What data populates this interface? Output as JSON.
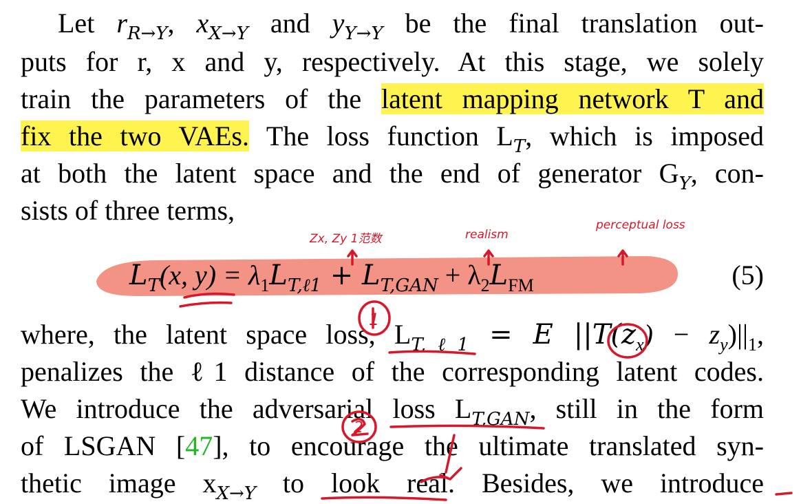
{
  "paragraph1": {
    "l1": [
      "Let ",
      "r",
      "R→Y",
      ", ",
      "x",
      "X→Y",
      " and ",
      "y",
      "Y→Y",
      " be the final translation out-"
    ],
    "l2": "puts for r, x and y, respectively. At this stage, we solely",
    "l3_pre": "train the parameters of the ",
    "l3_hl": "latent mapping network T and",
    "l4_hl": "fix the two VAEs.",
    "l4_post": " The loss function L",
    "l4_sub": "T",
    "l4_tail": ", which is imposed",
    "l5": "at both the latent space and the end of generator G",
    "l5_sub": "Y",
    "l5_tail": ", con-",
    "l6": "sists of three terms,"
  },
  "equation": {
    "lhs": "L",
    "lhs_sub": "T",
    "lhs_args": "(x, y) = λ",
    "t1_sub": "1",
    "t1": "L",
    "t1_subsub": "T,ℓ1",
    "plus1": " + L",
    "t2_sub": "T,GAN",
    "plus2": " + λ",
    "t3_sub": "2",
    "t3": "L",
    "t3_subsub": "FM",
    "number": "(5)"
  },
  "paragraph2": {
    "l1_pre": "where, the latent space loss, L",
    "l1_sub": "T,ℓ1",
    "l1_mid": " = E ||T(z",
    "l1_sub2": "x",
    "l1_mid2": ") − z",
    "l1_sub3": "y",
    "l1_tail": ")||",
    "l1_sub4": "1",
    "l1_end": ",",
    "l2": "penalizes the ℓ1 distance of the corresponding latent codes.",
    "l3_pre": "We introduce the adversarial loss L",
    "l3_sub": "T,GAN",
    "l3_tail": ", still in the form",
    "l4_pre": "of LSGAN [",
    "l4_cite": "47",
    "l4_tail": "], to encourage the ultimate translated syn-",
    "l5_pre": "thetic image x",
    "l5_sub": "X→Y",
    "l5_tail": " to look real. Besides, we introduce"
  },
  "annotations": {
    "note1": "Zx, Zy 1范数",
    "note2": "realism",
    "note3": "perceptual loss",
    "circle1": "1",
    "circle2": "2"
  },
  "colors": {
    "highlight": "#fff44f",
    "equation_marker": "#f08070",
    "pen": "#d8182a",
    "citation": "#22b822"
  }
}
